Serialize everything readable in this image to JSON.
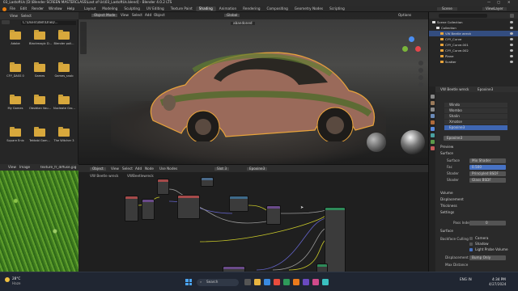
{
  "window_title": "03_LastoftUs [D:\\Blender SCREEN MASTERCLASS\\Last of Us\\03_LastoftUs.blend] - Blender 4.0.2 LTS",
  "menubar": {
    "menus": [
      "File",
      "Edit",
      "Render",
      "Window",
      "Help"
    ],
    "workspaces": [
      "Layout",
      "Modeling",
      "Sculpting",
      "UV Editing",
      "Texture Paint",
      "Shading",
      "Animation",
      "Rendering",
      "Compositing",
      "Geometry Nodes",
      "Scripting"
    ],
    "active_workspace": "Shading",
    "scene": "Scene",
    "view_layer": "ViewLayer"
  },
  "filebrowser": {
    "toolbar": [
      "View",
      "Select"
    ],
    "path": "C:\\Users\\dell\\OneD...",
    "folders": [
      "Adobe",
      "Blackmagic D...",
      "Blender poli...",
      "CFY_DASS 0",
      "Games",
      "Games_snob",
      "My Games",
      "Obsidian Vau...",
      "Nucleate Gro...",
      "Square Enix",
      "Tektabi Gam...",
      "The Witcher 3"
    ]
  },
  "viewport": {
    "mode": "Object Mode",
    "menus": [
      "View",
      "Select",
      "Add",
      "Object"
    ],
    "transform": "Global",
    "object_name": "abandoned",
    "options": "Options",
    "gizmo_axes": [
      "X",
      "Y",
      "Z"
    ]
  },
  "nodeeditor": {
    "editor": "Object",
    "menus": [
      "View",
      "Select",
      "Add",
      "Node"
    ],
    "use_nodes": "Use Nodes",
    "slot": "Slot 3",
    "material": "Epoxine3",
    "breadcrumb": [
      "VW Beetle wreck",
      "VWBeetlewreck"
    ],
    "header_items": [
      "Object",
      "Slot 3",
      "Epoxine3"
    ]
  },
  "imageeditor": {
    "menus": [
      "View",
      "Image"
    ],
    "image_name": "texture_fr_diffuse.jpg"
  },
  "outliner": {
    "title": "Scene Collection",
    "search_placeholder": "",
    "items": [
      {
        "label": "Scene Collection",
        "indent": 0,
        "selected": false
      },
      {
        "label": "Collection",
        "indent": 1,
        "selected": false
      },
      {
        "label": "VW Beetle wreck",
        "indent": 2,
        "selected": true
      },
      {
        "label": "CYY_Curve",
        "indent": 2,
        "selected": false
      },
      {
        "label": "CYY_Curve.001",
        "indent": 2,
        "selected": false
      },
      {
        "label": "CYY_Curve.002",
        "indent": 2,
        "selected": false
      },
      {
        "label": "Plane",
        "indent": 2,
        "selected": false
      },
      {
        "label": "Scatter",
        "indent": 2,
        "selected": false
      }
    ]
  },
  "properties": {
    "object": "VW Beetle wreck",
    "material": "Epoxine3",
    "material_slots": [
      "Windo",
      "Wombo",
      "Shalin",
      "Xmatse",
      "Epoxine3"
    ],
    "active_slot": "Epoxine3",
    "material_field": "Epoxine3",
    "sections": [
      "Preview",
      "Surface"
    ],
    "surface_rows": [
      {
        "label": "Surface",
        "value": "Mix Shader"
      },
      {
        "label": "Fac",
        "value": "0.500"
      },
      {
        "label": "Shader",
        "value": "Principled BSDF"
      },
      {
        "label": "Shader",
        "value": "Glass BSDF"
      }
    ],
    "more_sections": [
      "Volume",
      "Displacement",
      "Thickness",
      "Settings"
    ],
    "pass_index_label": "Pass Index",
    "pass_index_value": "0",
    "surface_sub": "Surface",
    "backface_culling_label": "Backface Culling",
    "checkboxes": [
      {
        "label": "Camera",
        "checked": false
      },
      {
        "label": "Shadow",
        "checked": false
      },
      {
        "label": "Light Probe Volume",
        "checked": true
      }
    ],
    "displacement_label": "Displacement",
    "displacement_value": "Bump Only",
    "last_row_label": "Max Distance"
  },
  "taskbar": {
    "weather_temp": "28°C",
    "weather_text": "Haze",
    "search": "Search",
    "lang": "ENG\nIN",
    "time": "4:34 PM",
    "date": "4/27/2024"
  },
  "colors": {
    "accent": "#3f67b3",
    "outline_selected": "#e8a33a",
    "folder": "#d8a83c"
  }
}
